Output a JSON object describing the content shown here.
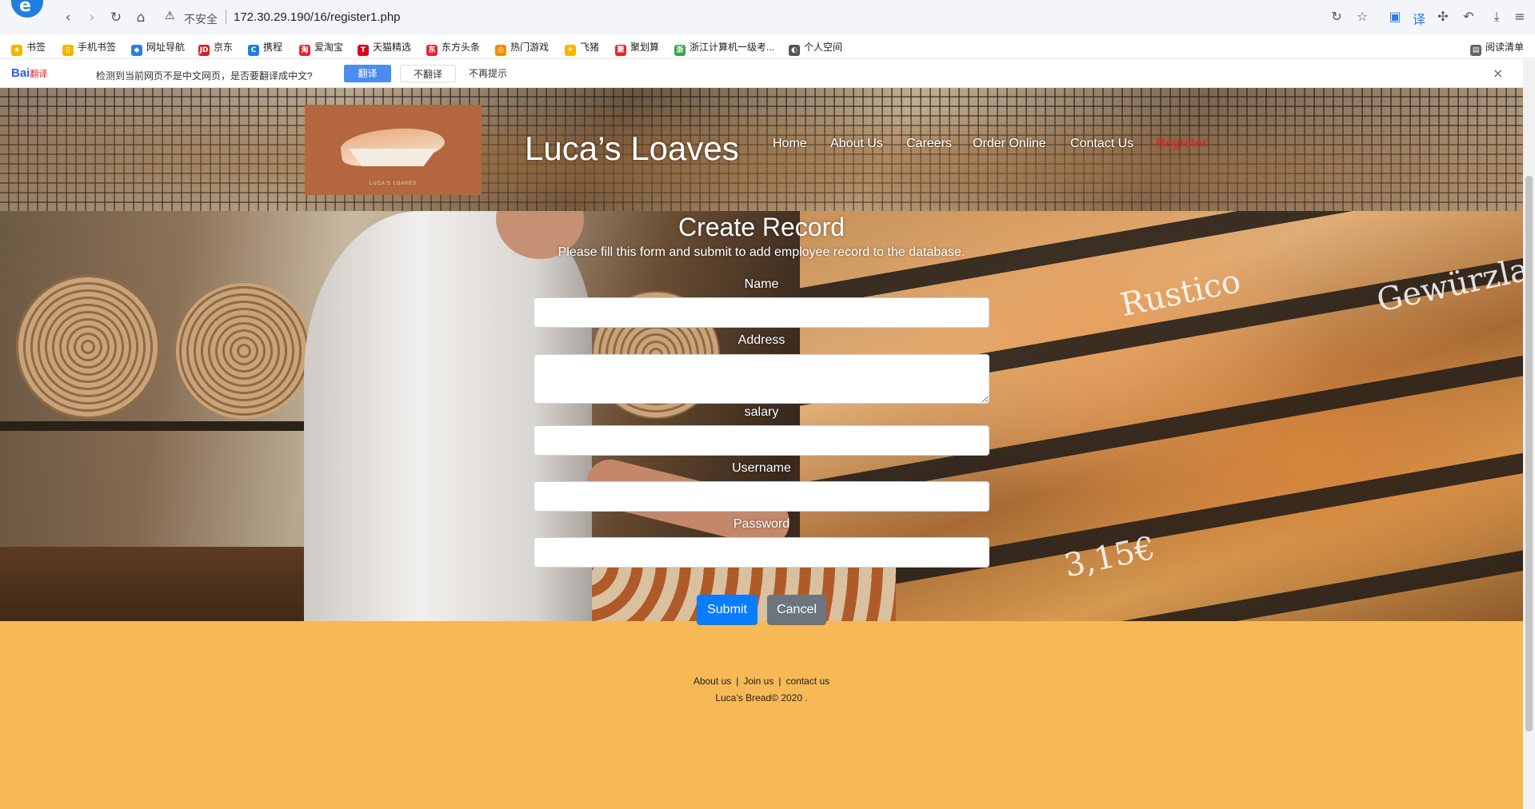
{
  "browser": {
    "insecure_label": "不安全",
    "url": "172.30.29.190/16/register1.php",
    "bookmarks": [
      {
        "label": "书签",
        "color": "#f5b400",
        "glyph": "★"
      },
      {
        "label": "手机书签",
        "color": "#f5b400",
        "glyph": "▯"
      },
      {
        "label": "网址导航",
        "color": "#2b7de9",
        "glyph": "◆"
      },
      {
        "label": "京东",
        "color": "#d71d25",
        "glyph": "JD"
      },
      {
        "label": "携程",
        "color": "#1e7fe0",
        "glyph": "C"
      },
      {
        "label": "爱淘宝",
        "color": "#e2262d",
        "glyph": "淘"
      },
      {
        "label": "天猫精选",
        "color": "#d8001a",
        "glyph": "T"
      },
      {
        "label": "东方头条",
        "color": "#e2262d",
        "glyph": "东"
      },
      {
        "label": "热门游戏",
        "color": "#f08c00",
        "glyph": "◎"
      },
      {
        "label": "飞猪",
        "color": "#f5b400",
        "glyph": "✈"
      },
      {
        "label": "聚划算",
        "color": "#e2262d",
        "glyph": "聚"
      },
      {
        "label": "浙江计算机一级考...",
        "color": "#3aa34a",
        "glyph": "浙"
      },
      {
        "label": "个人空间",
        "color": "#555555",
        "glyph": "◐"
      },
      {
        "label": "阅读清单",
        "color": "#666666",
        "glyph": "▤"
      }
    ],
    "translate": {
      "brand": "Bai",
      "brand_sub": "翻译",
      "message": "检测到当前网页不是中文网页，是否要翻译成中文?",
      "translate_btn": "翻译",
      "no_translate_btn": "不翻译",
      "never_btn": "不再提示"
    }
  },
  "site": {
    "title": "Luca’s Loaves",
    "logo_tagline": "LUCA’S LOAVES",
    "nav": [
      "Home",
      "About Us",
      "Careers",
      "Order Online",
      "Contact Us",
      "Register"
    ],
    "active_nav": "Register"
  },
  "form": {
    "title": "Create Record",
    "description": "Please fill this form and submit to add employee record to the database.",
    "labels": {
      "name": "Name",
      "address": "Address",
      "salary": "salary",
      "username": "Username",
      "password": "Password"
    },
    "submit": "Submit",
    "cancel": "Cancel"
  },
  "hero_chalk": [
    "Rustico",
    "Gewürzla",
    "3,15€"
  ],
  "footer": {
    "links": [
      "About us",
      "Join us",
      "contact us"
    ],
    "copyright": "Luca’s Bread© 2020 ."
  },
  "colors": {
    "accent_blue": "#0a7cff",
    "cancel_gray": "#6c757d",
    "footer_bg": "#f6b956",
    "active_nav": "#d22d2d"
  }
}
